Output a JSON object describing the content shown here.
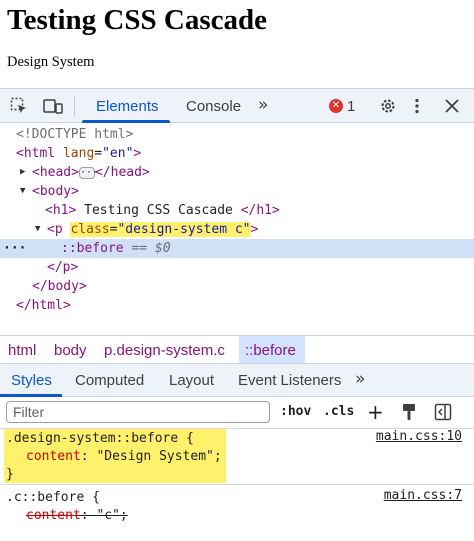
{
  "page": {
    "heading": "Testing CSS Cascade",
    "paragraph": "Design System"
  },
  "toolbar": {
    "tabs": [
      "Elements",
      "Console"
    ],
    "more_tabs": "»",
    "error_count": "1",
    "icons": [
      "select-element-icon",
      "device-toolbar-icon",
      "error-icon",
      "settings-icon",
      "kebab-menu-icon",
      "close-icon"
    ]
  },
  "dom": {
    "doctype": "<!DOCTYPE html>",
    "html_open_tag": "<html",
    "html_attr": "lang",
    "html_attr_val": "\"en\"",
    "html_close": ">",
    "head_tag": "<head>",
    "head_ellipsis": "···",
    "head_close": "</head>",
    "body_tag": "<body>",
    "h1_open": "<h1>",
    "h1_text": " Testing CSS Cascade ",
    "h1_close": "</h1>",
    "p_open": "<p",
    "p_attr": "class",
    "p_attr_val": "\"design-system c\"",
    "p_gt": ">",
    "gutter_dots": "···",
    "pseudo": "::before",
    "pseudo_ref": "== $0",
    "p_close": "</p>",
    "body_close": "</body>",
    "html_close_tag": "</html>"
  },
  "breadcrumb": [
    "html",
    "body",
    "p.design-system.c",
    "::before"
  ],
  "subtabs": [
    "Styles",
    "Computed",
    "Layout",
    "Event Listeners"
  ],
  "subtabs_more": "»",
  "filter": {
    "placeholder": "Filter",
    "hov": ":hov",
    "cls": ".cls",
    "plus": "+"
  },
  "rules": [
    {
      "selector": ".design-system::before {",
      "property": "content",
      "value": "\"Design System\";",
      "close": "}",
      "source": "main.css:10"
    },
    {
      "selector": ".c::before {",
      "property": "content",
      "value": "\"c\";",
      "source": "main.css:7"
    }
  ],
  "colors": {
    "accent": "#0b57d0",
    "tag": "#881280",
    "attr_name": "#994500",
    "attr_value": "#1a1aa6",
    "highlight": "#fff16b",
    "error": "#dc362e"
  }
}
